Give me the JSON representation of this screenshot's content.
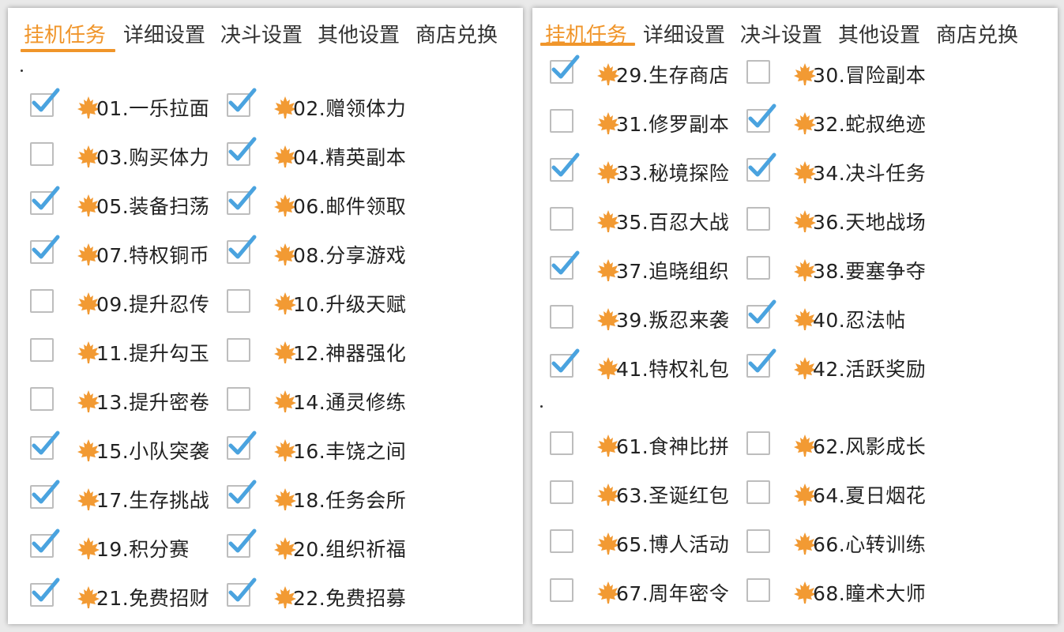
{
  "tabs": [
    "挂机任务",
    "详细设置",
    "决斗设置",
    "其他设置",
    "商店兑换"
  ],
  "active_tab": 0,
  "accent_color": "#f0952a",
  "check_color": "#4aa3df",
  "leaf_color": "#f29a33",
  "left_panel": {
    "tasks": [
      {
        "label": "01.一乐拉面",
        "checked": true
      },
      {
        "label": "02.赠领体力",
        "checked": true
      },
      {
        "label": "03.购买体力",
        "checked": false
      },
      {
        "label": "04.精英副本",
        "checked": true
      },
      {
        "label": "05.装备扫荡",
        "checked": true
      },
      {
        "label": "06.邮件领取",
        "checked": true
      },
      {
        "label": "07.特权铜币",
        "checked": true
      },
      {
        "label": "08.分享游戏",
        "checked": true
      },
      {
        "label": "09.提升忍传",
        "checked": false
      },
      {
        "label": "10.升级天赋",
        "checked": false
      },
      {
        "label": "11.提升勾玉",
        "checked": false
      },
      {
        "label": "12.神器强化",
        "checked": false
      },
      {
        "label": "13.提升密卷",
        "checked": false
      },
      {
        "label": "14.通灵修练",
        "checked": false
      },
      {
        "label": "15.小队突袭",
        "checked": true
      },
      {
        "label": "16.丰饶之间",
        "checked": true
      },
      {
        "label": "17.生存挑战",
        "checked": true
      },
      {
        "label": "18.任务会所",
        "checked": true
      },
      {
        "label": "19.积分赛",
        "checked": true
      },
      {
        "label": "20.组织祈福",
        "checked": true
      },
      {
        "label": "21.免费招财",
        "checked": true
      },
      {
        "label": "22.免费招募",
        "checked": true
      }
    ]
  },
  "right_panel": {
    "tasks_a": [
      {
        "label": "29.生存商店",
        "checked": true
      },
      {
        "label": "30.冒险副本",
        "checked": false
      },
      {
        "label": "31.修罗副本",
        "checked": false
      },
      {
        "label": "32.蛇叔绝迹",
        "checked": true
      },
      {
        "label": "33.秘境探险",
        "checked": true
      },
      {
        "label": "34.决斗任务",
        "checked": true
      },
      {
        "label": "35.百忍大战",
        "checked": false
      },
      {
        "label": "36.天地战场",
        "checked": false
      },
      {
        "label": "37.追晓组织",
        "checked": true
      },
      {
        "label": "38.要塞争夺",
        "checked": false
      },
      {
        "label": "39.叛忍来袭",
        "checked": false
      },
      {
        "label": "40.忍法帖",
        "checked": true
      },
      {
        "label": "41.特权礼包",
        "checked": true
      },
      {
        "label": "42.活跃奖励",
        "checked": true
      }
    ],
    "tasks_b": [
      {
        "label": "61.食神比拼",
        "checked": false
      },
      {
        "label": "62.风影成长",
        "checked": false
      },
      {
        "label": "63.圣诞红包",
        "checked": false
      },
      {
        "label": "64.夏日烟花",
        "checked": false
      },
      {
        "label": "65.博人活动",
        "checked": false
      },
      {
        "label": "66.心转训练",
        "checked": false
      },
      {
        "label": "67.周年密令",
        "checked": false
      },
      {
        "label": "68.瞳术大师",
        "checked": false
      }
    ]
  }
}
